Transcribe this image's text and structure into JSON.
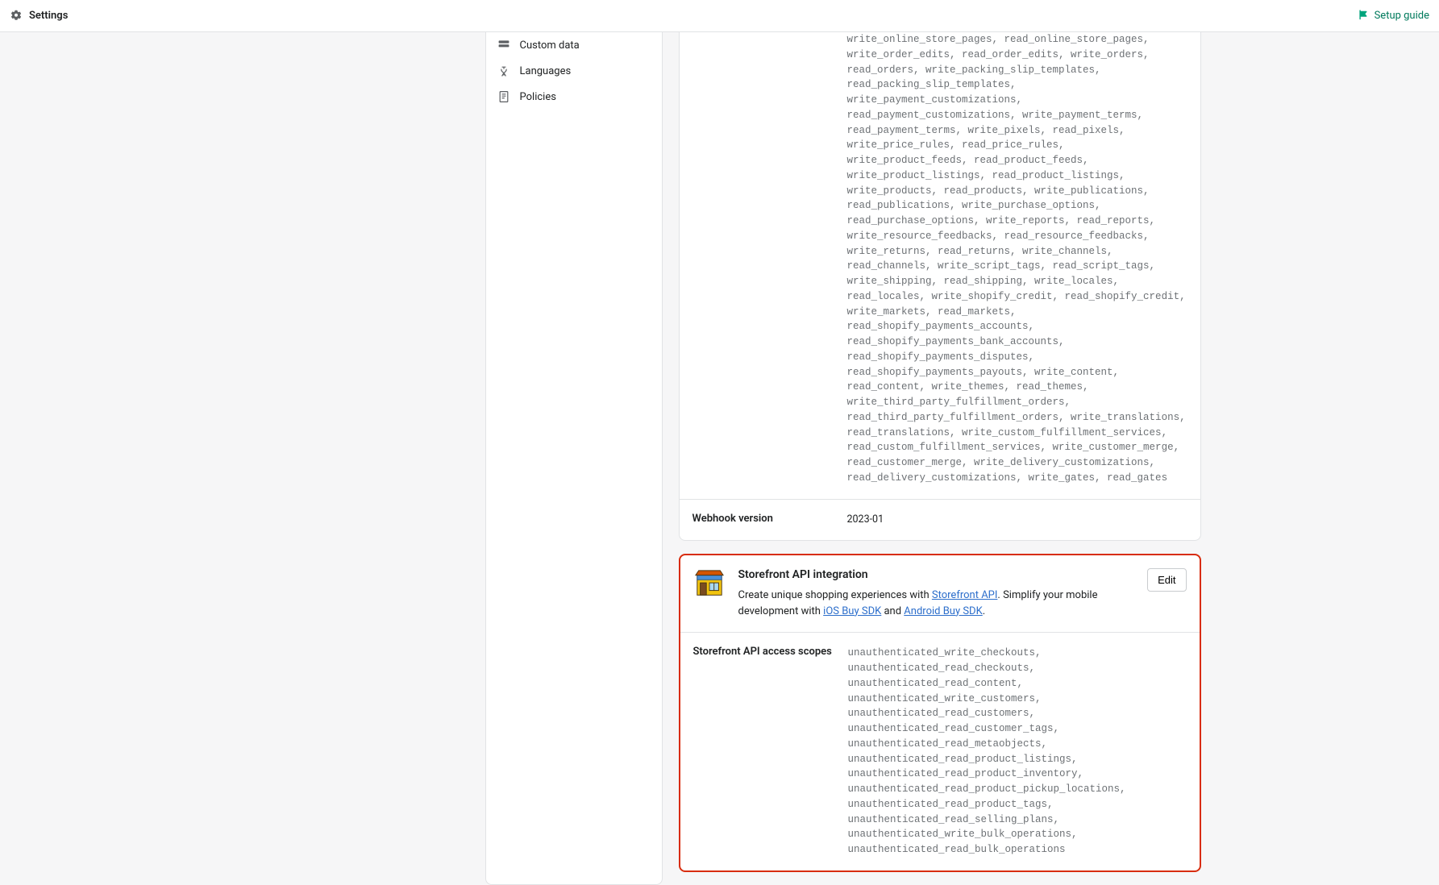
{
  "topbar": {
    "title": "Settings",
    "setup_guide": "Setup guide"
  },
  "sidebar": {
    "items": [
      {
        "label": "Custom data"
      },
      {
        "label": "Languages"
      },
      {
        "label": "Policies"
      }
    ]
  },
  "admin_section": {
    "scopes_text": "write_online_store_pages, read_online_store_pages, write_order_edits, read_order_edits, write_orders, read_orders, write_packing_slip_templates, read_packing_slip_templates, write_payment_customizations, read_payment_customizations, write_payment_terms, read_payment_terms, write_pixels, read_pixels, write_price_rules, read_price_rules, write_product_feeds, read_product_feeds, write_product_listings, read_product_listings, write_products, read_products, write_publications, read_publications, write_purchase_options, read_purchase_options, write_reports, read_reports, write_resource_feedbacks, read_resource_feedbacks, write_returns, read_returns, write_channels, read_channels, write_script_tags, read_script_tags, write_shipping, read_shipping, write_locales, read_locales, write_shopify_credit, read_shopify_credit, write_markets, read_markets, read_shopify_payments_accounts, read_shopify_payments_bank_accounts, read_shopify_payments_disputes, read_shopify_payments_payouts, write_content, read_content, write_themes, read_themes, write_third_party_fulfillment_orders, read_third_party_fulfillment_orders, write_translations, read_translations, write_custom_fulfillment_services, read_custom_fulfillment_services, write_customer_merge, read_customer_merge, write_delivery_customizations, read_delivery_customizations, write_gates, read_gates",
    "webhook_label": "Webhook version",
    "webhook_value": "2023-01"
  },
  "storefront_section": {
    "title": "Storefront API integration",
    "edit_label": "Edit",
    "desc_prefix": "Create unique shopping experiences with ",
    "link1": "Storefront API",
    "desc_mid": ". Simplify your mobile development with ",
    "link2": "iOS Buy SDK",
    "desc_and": " and ",
    "link3": "Android Buy SDK",
    "desc_suffix": ".",
    "scopes_label": "Storefront API access scopes",
    "scopes_text": "unauthenticated_write_checkouts, unauthenticated_read_checkouts, unauthenticated_read_content, unauthenticated_write_customers, unauthenticated_read_customers, unauthenticated_read_customer_tags, unauthenticated_read_metaobjects, unauthenticated_read_product_listings, unauthenticated_read_product_inventory, unauthenticated_read_product_pickup_locations, unauthenticated_read_product_tags, unauthenticated_read_selling_plans, unauthenticated_write_bulk_operations, unauthenticated_read_bulk_operations"
  }
}
